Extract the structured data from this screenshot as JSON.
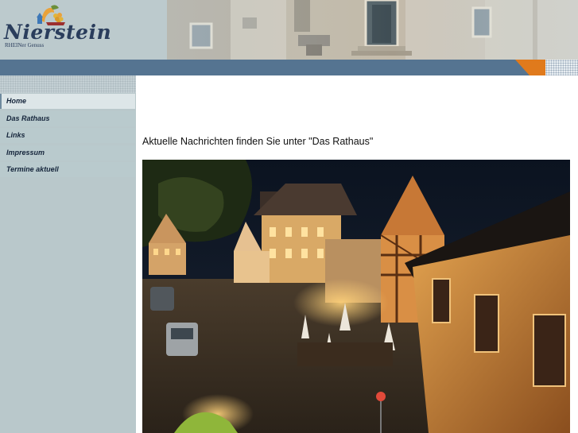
{
  "header": {
    "logo_title": "Nierstein",
    "logo_subtitle": "RHEINer Genuss"
  },
  "nav": {
    "items": [
      {
        "label": "Home",
        "active": true
      },
      {
        "label": "Das Rathaus",
        "active": false
      },
      {
        "label": "Links",
        "active": false
      },
      {
        "label": "Impressum",
        "active": false
      },
      {
        "label": "Termine aktuell",
        "active": false
      }
    ]
  },
  "main": {
    "news_text": "Aktuelle Nachrichten finden Sie unter \"Das Rathaus\""
  },
  "colors": {
    "header_bg": "#b9c8cb",
    "blue_bar": "#557491",
    "accent_orange": "#e07a1c",
    "sidebar_bg": "#b9c8cb",
    "nav_active_bg": "#dde6e8",
    "logo_text": "#2a3d5c"
  },
  "icons": {
    "logo_mark": "grape-bunch-logo-icon"
  }
}
